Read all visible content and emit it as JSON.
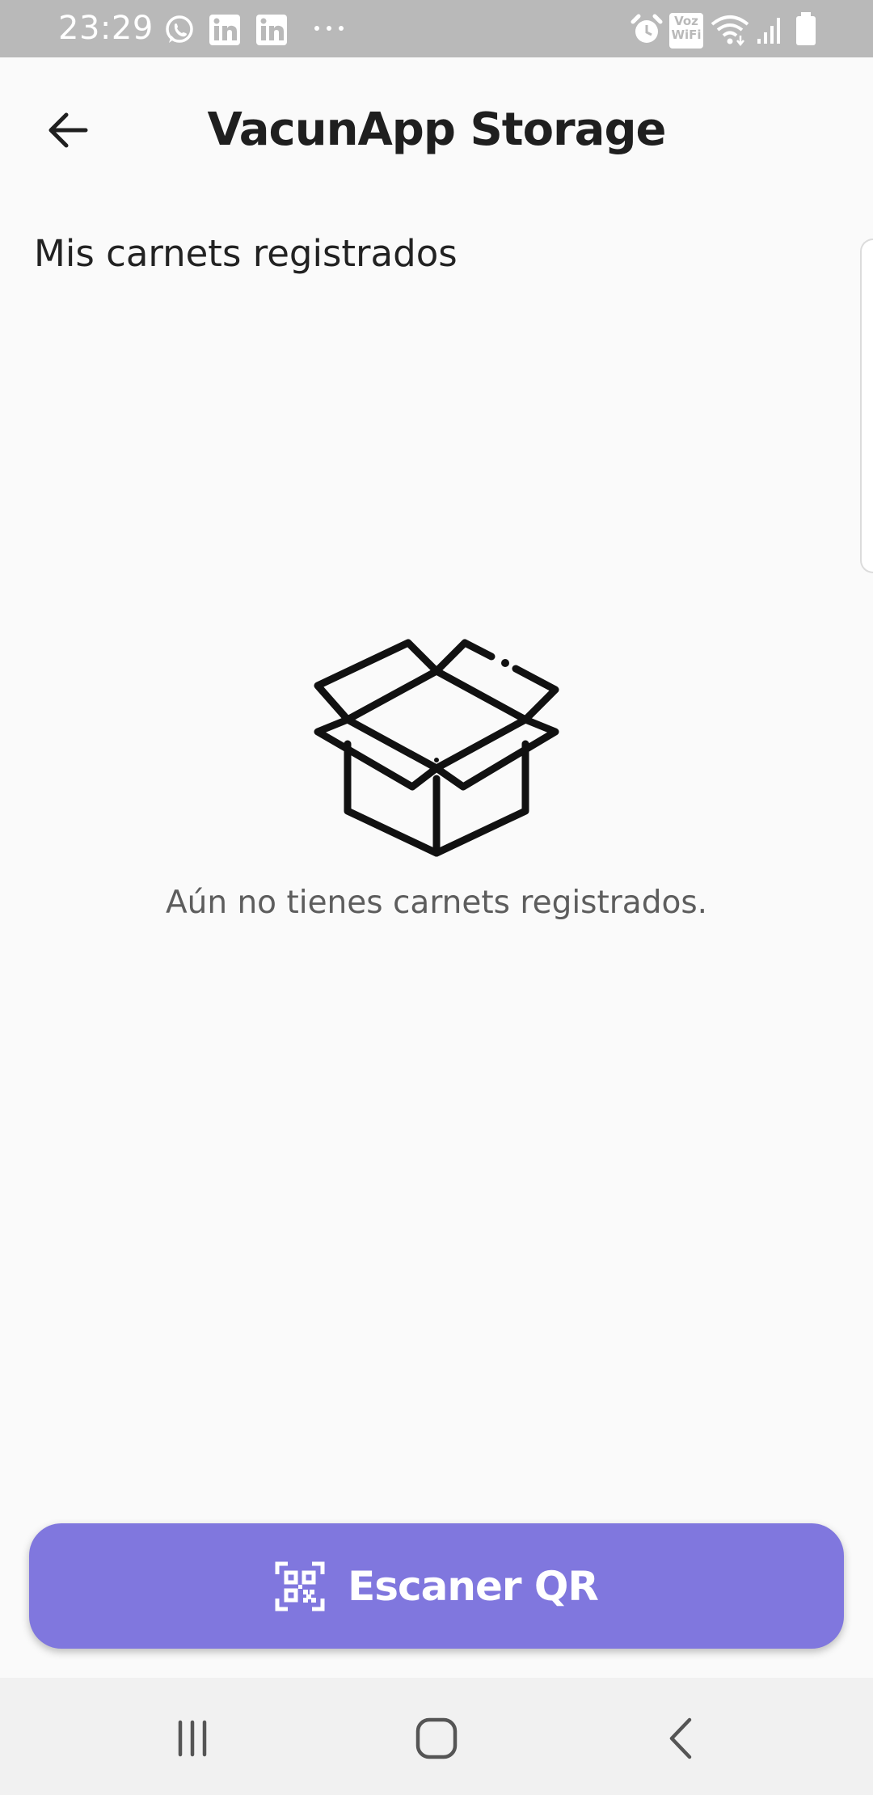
{
  "status_bar": {
    "time": "23:29",
    "left_icons": [
      "whatsapp-icon",
      "linkedin-icon",
      "linkedin-icon",
      "more-dots-icon"
    ],
    "right_icons": [
      "alarm-icon",
      "voz-wifi-icon",
      "wifi-icon",
      "signal-icon",
      "battery-icon"
    ],
    "voz_line1": "Voz",
    "voz_line2": "WiFi"
  },
  "app_bar": {
    "title": "VacunApp Storage",
    "back_icon": "arrow-left-icon"
  },
  "main": {
    "section_title": "Mis carnets registrados",
    "empty_state": {
      "icon": "open-box-icon",
      "message": "Aún no tienes carnets registrados."
    }
  },
  "scan_button": {
    "label": "Escaner QR",
    "icon": "qr-code-icon",
    "color": "#8077de"
  },
  "nav_bar": {
    "items": [
      "recent-apps-icon",
      "home-icon",
      "back-icon"
    ]
  },
  "colors": {
    "status_bar": "#b9b9b9",
    "background": "#fafafa",
    "accent": "#8077de"
  }
}
